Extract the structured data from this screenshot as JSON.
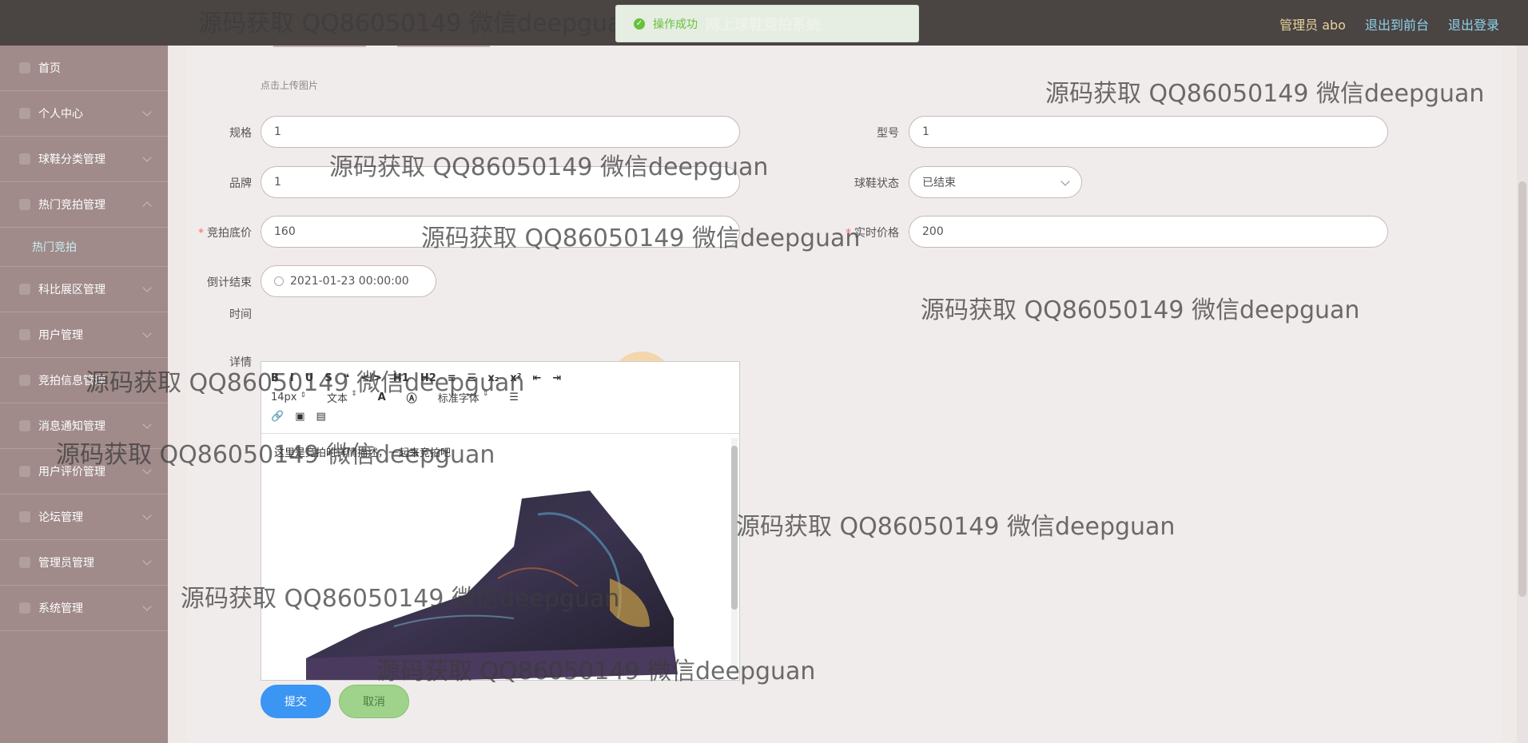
{
  "topbar": {
    "admin": "管理员 abo",
    "front": "退出到前台",
    "logout": "退出登录"
  },
  "toast": {
    "message": "操作成功",
    "system_title": "网上球鞋竞拍系统"
  },
  "sidebar": {
    "items": [
      {
        "label": "首页"
      },
      {
        "label": "个人中心"
      },
      {
        "label": "球鞋分类管理"
      },
      {
        "label": "热门竞拍管理"
      },
      {
        "label": "科比展区管理"
      },
      {
        "label": "用户管理"
      },
      {
        "label": "竞拍信息管理"
      },
      {
        "label": "消息通知管理"
      },
      {
        "label": "用户评价管理"
      },
      {
        "label": "论坛管理"
      },
      {
        "label": "管理员管理"
      },
      {
        "label": "系统管理"
      }
    ],
    "sub_item": "热门竞拍"
  },
  "form": {
    "upload_tip": "点击上传图片",
    "spec_label": "规格",
    "spec_value": "1",
    "model_label": "型号",
    "model_value": "1",
    "brand_label": "品牌",
    "brand_value": "1",
    "status_label": "球鞋状态",
    "status_value": "已结束",
    "base_price_label": "竞拍底价",
    "base_price_value": "160",
    "realtime_price_label": "实时价格",
    "realtime_price_value": "200",
    "countdown_label_1": "倒计结束",
    "countdown_label_2": "时间",
    "countdown_value": "2021-01-23 00:00:00",
    "details_label": "详情",
    "editor_text": "这里是竞拍时详情描述，一起来竞拍吧",
    "submit": "提交",
    "cancel": "取消"
  },
  "editor_toolbar": {
    "row1": [
      "B",
      "I",
      "U",
      "S",
      "❝",
      "</>",
      "H1",
      "H2",
      "≡",
      "☰",
      "x₂",
      "x²",
      "⇤",
      "⇥"
    ],
    "font_size": "14px",
    "text_type": "文本",
    "font_family": "标准字体"
  },
  "watermark_text": "源码获取 QQ86050149 微信deepguan"
}
